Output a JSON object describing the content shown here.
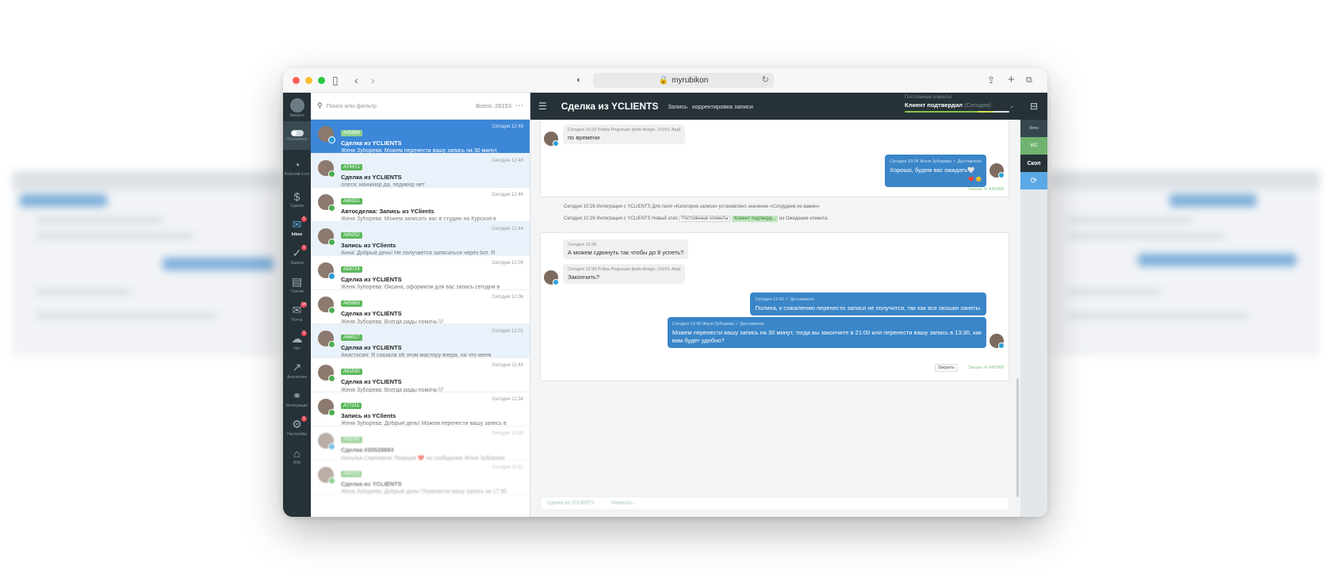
{
  "browser": {
    "url": "myrubikon"
  },
  "nav": {
    "items": [
      {
        "label": "Аккаунт"
      },
      {
        "label": "Отключено"
      },
      {
        "label": "Рабочий стол"
      },
      {
        "label": "Сделки"
      },
      {
        "label": "Inbox",
        "badge": "1"
      },
      {
        "label": "Задачи",
        "badge": "1"
      },
      {
        "label": "Списки"
      },
      {
        "label": "Почта",
        "badge": "14"
      },
      {
        "label": "Чат",
        "badge": "1"
      },
      {
        "label": "Аналитика"
      },
      {
        "label": "Интеграции"
      },
      {
        "label": "Настройки",
        "badge": "1"
      },
      {
        "label": "Wiki"
      }
    ]
  },
  "list": {
    "search_placeholder": "Поиск или фильтр",
    "total": "Всего: 26153",
    "items": [
      {
        "tag": "A45988",
        "time": "Сегодня 12:49",
        "title": "Сделка из YCLIENTS",
        "preview": "Женя Зуборева: Можем перенести вашу запись на 30 минут,"
      },
      {
        "tag": "A74471",
        "time": "Сегодня 12:48",
        "title": "Сделка из YCLIENTS",
        "preview": "олеся: маникюр да, педикюр нет"
      },
      {
        "tag": "A86251",
        "time": "Сегодня 12:46",
        "title": "Автосделка: Запись из YClients",
        "preview": "Женя Зуборева: Можем записать вас в студию на Курской в"
      },
      {
        "tag": "A86252",
        "time": "Сегодня 12:44",
        "title": "Запись из YClients",
        "preview": "Анна: Добрый день! Не получается записаться через бот. Я"
      },
      {
        "tag": "A58774",
        "time": "Сегодня 12:09",
        "title": "Сделка из YCLIENTS",
        "preview": "Женя Зуборева: Оксана, оформили для вас запись сегодня в"
      },
      {
        "tag": "A65963",
        "time": "Сегодня 12:06",
        "title": "Сделка из YCLIENTS",
        "preview": "Женя Зуборева: Всегда рады помочь🤍"
      },
      {
        "tag": "A86017",
        "time": "Сегодня 12:02",
        "title": "Сделка из YCLIENTS",
        "preview": "Анастасия: Я сказала об этом мастеру вчера, на что меня"
      },
      {
        "tag": "A81530",
        "time": "Сегодня 11:44",
        "title": "Сделка из YCLIENTS",
        "preview": "Женя Зуборева: Всегда рады помочь🤍"
      },
      {
        "tag": "A77211",
        "time": "Сегодня 11:34",
        "title": "Запись из YClients",
        "preview": "Женя Зуборева: Добрый день! Можем перенести вашу запись в"
      },
      {
        "tag": "A86240",
        "time": "Сегодня 10:35",
        "title": "Сделка #30528893",
        "preview": "Наталья Сергеевна: Реакция ❤️ на сообщение Женя Зуборева"
      },
      {
        "tag": "A86115",
        "time": "Сегодня 10:31",
        "title": "Сделка из YCLIENTS",
        "preview": "Женя Зуборева: Добрый день! Перенесли вашу запись на 17:30"
      }
    ]
  },
  "deal": {
    "title": "Сделка из YCLIENTS",
    "crumb1": "Запись",
    "crumb2": "корректировка записи",
    "stage_label": "Постоянные клиенты",
    "stage_value": "Клиент подтвердил",
    "stage_note": "(Сегодня)"
  },
  "messages": {
    "m1_meta": "Сегодня 10:23 Polina Pogosyan [web-design, UX/UI, App]",
    "m1_text": "по времени",
    "m2_meta": "Сегодня 10:24 Женя Зуборева ✓ Доставлено",
    "m2_text": "Хорошо, будем вас ожидать🤍",
    "m2_reacts": "❤️ 😊",
    "card1_actions": "Заказы ✉ A45988",
    "sys1": "Сегодня 10:26 Интеграция с YCLIENTS Для поля «Категория записи» установлено значение «Сотрудник не важен»",
    "sys2_a": "Сегодня 10:26 Интеграция с YCLIENTS Новый этап",
    "sys2_chip1": "Постоянные клиенты",
    "sys2_chip2": "Клиент подтверд...",
    "sys2_b": "из Ожидание клиента",
    "m3_meta": "Сегодня 12:36",
    "m3_text": "А можем сдвинуть так чтобы до 8 успеть?",
    "m4_meta": "Сегодня 12:36 Polina Pogosyan [web-design, UX/UI, App]",
    "m4_text": "Закончить?",
    "m5_meta": "Сегодня 12:42 ✓ Доставлено",
    "m5_text": "Полина, к сожалению перенести записи не получится, так как все окошки заняты.",
    "m6_meta": "Сегодня 12:49 Женя Зуборева ✓ Доставлено",
    "m6_text1": "Можем перенести вашу запись на 30 минут, тогда вы закончите в 21:00 или перенести вашу запись в 13:30, как",
    "m6_text2": "вам будет удобно?",
    "close": "Закрыть",
    "card2_actions": "Заказы ✉ A45988"
  },
  "composer": {
    "placeholder": "Сделка из YCLIENTS",
    "hint": "Написать..."
  },
  "rail": {
    "item1": "Фото",
    "item2": "WZ",
    "item3": "Скоп",
    "item4": "⟳"
  }
}
